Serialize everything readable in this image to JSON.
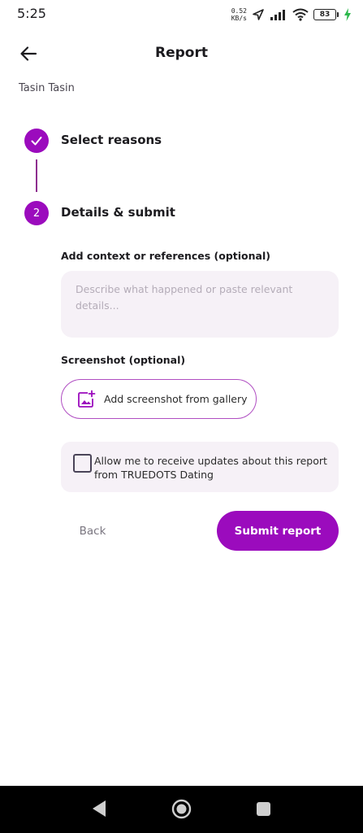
{
  "status_bar": {
    "time": "5:25",
    "net_speed_value": "0.52",
    "net_speed_unit": "KB/s",
    "battery": "83"
  },
  "header": {
    "title": "Report",
    "back_icon": "arrow-left-icon"
  },
  "reported_user": "Tasin Tasin",
  "stepper": {
    "steps": [
      {
        "label": "Select reasons",
        "state": "completed",
        "icon": "check-icon"
      },
      {
        "number": "2",
        "label": "Details & submit",
        "state": "active"
      }
    ]
  },
  "form": {
    "context_label": "Add context or references (optional)",
    "context_value": "",
    "context_placeholder": "Describe what happened or paste relevant details...",
    "screenshot_label": "Screenshot (optional)",
    "gallery_button_label": "Add screenshot from gallery",
    "gallery_icon": "add-photo-icon",
    "updates_checkbox_checked": false,
    "updates_text": "Allow me to receive updates about this report from TRUEDOTS Dating"
  },
  "actions": {
    "back_label": "Back",
    "submit_label": "Submit report"
  },
  "colors": {
    "accent": "#9b0bbd",
    "field_background": "#f6f1f7",
    "outline": "#b04ec2"
  }
}
